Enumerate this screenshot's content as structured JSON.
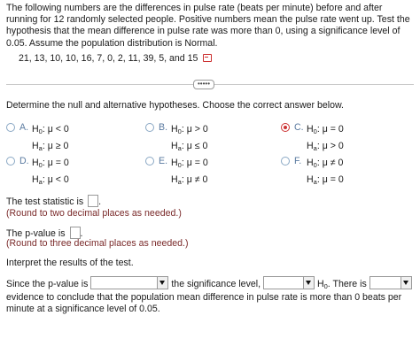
{
  "problem": {
    "text": "The following numbers are the differences in pulse rate (beats per minute) before and after running for 12 randomly selected people. Positive numbers mean the pulse rate went up. Test the hypothesis that the mean difference in pulse rate was more than 0, using a significance level of 0.05. Assume the population distribution is Normal.",
    "data": "21, 13, 10, 10, 16, 7, 0, 2, 11, 39, 5, and 15"
  },
  "more_button": "•••••",
  "question": {
    "prompt": "Determine the null and alternative hypotheses. Choose the correct answer below.",
    "options": [
      {
        "letter": "A.",
        "h0": "μ < 0",
        "ha": "μ ≥ 0",
        "selected": false
      },
      {
        "letter": "B.",
        "h0": "μ > 0",
        "ha": "μ ≤ 0",
        "selected": false
      },
      {
        "letter": "C.",
        "h0": "μ = 0",
        "ha": "μ > 0",
        "selected": true
      },
      {
        "letter": "D.",
        "h0": "μ = 0",
        "ha": "μ < 0",
        "selected": false
      },
      {
        "letter": "E.",
        "h0": "μ = 0",
        "ha": "μ ≠ 0",
        "selected": false
      },
      {
        "letter": "F.",
        "h0": "μ ≠ 0",
        "ha": "μ = 0",
        "selected": false
      }
    ]
  },
  "test_statistic": {
    "label": "The test statistic is",
    "note": "(Round to two decimal places as needed.)",
    "value": ""
  },
  "p_value": {
    "label": "The p-value is",
    "note": "(Round to three decimal places as needed.)",
    "value": ""
  },
  "interpret": {
    "label": "Interpret the results of the test."
  },
  "conclusion": {
    "part1": "Since the p-value is",
    "part2": "the significance level,",
    "part3": ". There is",
    "part4": "evidence to conclude that the population mean difference in pulse rate is more than 0 beats per minute at a significance level of 0.05."
  },
  "symbols": {
    "H": "H",
    "H0_sub": "0",
    "Ha_sub": "a"
  },
  "colors": {
    "selected_radio": "#cc3333",
    "radio_border": "#8aa8c4",
    "option_letter": "#5a7aa0"
  }
}
